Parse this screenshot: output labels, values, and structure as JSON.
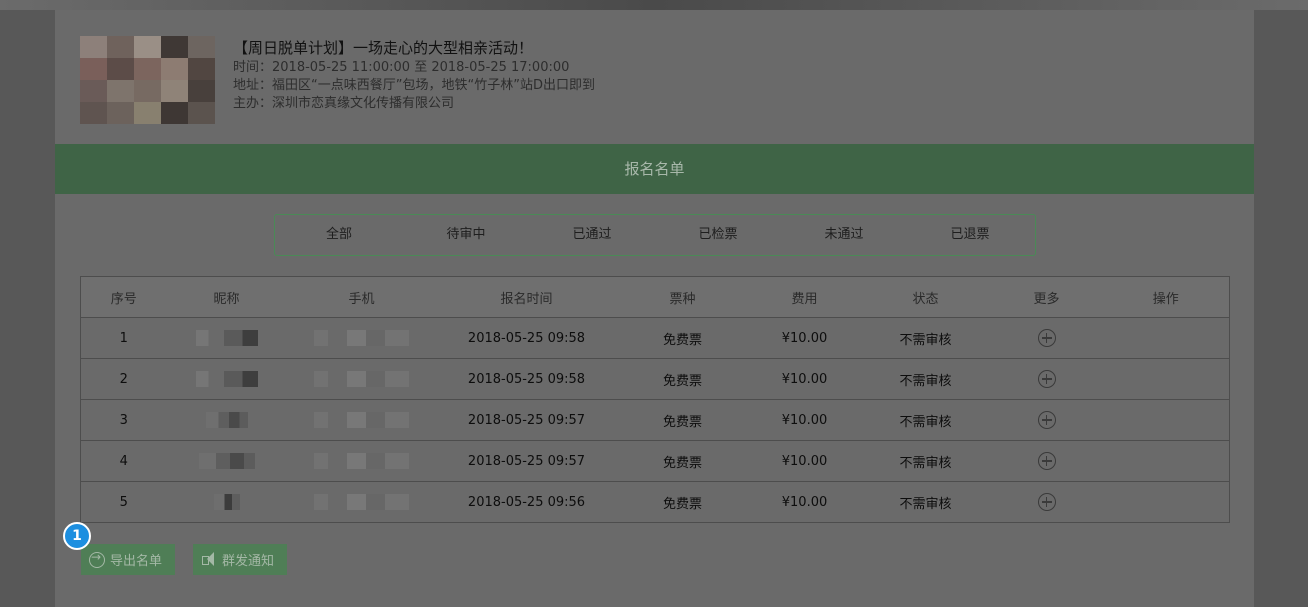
{
  "event": {
    "title": "【周日脱单计划】一场走心的大型相亲活动！",
    "time": "时间：2018-05-25 11:00:00 至 2018-05-25 17:00:00",
    "address": "地址：福田区“一点味西餐厅”包场，地铁“竹子林”站D出口即到",
    "host": "主办：深圳市恋真缘文化传播有限公司"
  },
  "section_title": "报名名单",
  "filters": [
    "全部",
    "待审中",
    "已通过",
    "已检票",
    "未通过",
    "已退票"
  ],
  "table": {
    "headers": [
      "序号",
      "昵称",
      "手机",
      "报名时间",
      "票种",
      "费用",
      "状态",
      "更多",
      "操作"
    ],
    "rows": [
      {
        "no": "1",
        "time": "2018-05-25 09:58",
        "ticket": "免费票",
        "fee": "¥10.00",
        "status": "不需审核"
      },
      {
        "no": "2",
        "time": "2018-05-25 09:58",
        "ticket": "免费票",
        "fee": "¥10.00",
        "status": "不需审核"
      },
      {
        "no": "3",
        "time": "2018-05-25 09:57",
        "ticket": "免费票",
        "fee": "¥10.00",
        "status": "不需审核"
      },
      {
        "no": "4",
        "time": "2018-05-25 09:57",
        "ticket": "免费票",
        "fee": "¥10.00",
        "status": "不需审核"
      },
      {
        "no": "5",
        "time": "2018-05-25 09:56",
        "ticket": "免费票",
        "fee": "¥10.00",
        "status": "不需审核"
      }
    ]
  },
  "actions": {
    "export": "导出名单",
    "notify": "群发通知"
  },
  "tour_badge": "1",
  "colors": {
    "header_bar": "#3f6446",
    "filter_border": "#4a8a56",
    "button_bg": "#4f7e56",
    "badge": "#1d8fe0"
  }
}
